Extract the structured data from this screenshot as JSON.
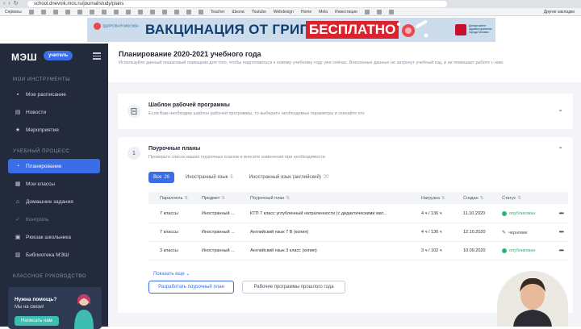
{
  "browser": {
    "url": "school.dnevnik.mos.ru/journal/study/plans",
    "bookmarks": [
      "Сервисы",
      "",
      "",
      "",
      "",
      "",
      "",
      "",
      "",
      "",
      "",
      "",
      "",
      "",
      "",
      "",
      "Teacher",
      "Школа",
      "Youtube",
      "Webdesign",
      "Home",
      "Mela",
      "Инвестиции",
      "",
      "",
      ""
    ],
    "other_bookmarks": "Другие закладки"
  },
  "banner": {
    "logo_text": "ЗДОРОВАЯ МОСКВА",
    "headline": "ВАКЦИНАЦИЯ ОТ ГРИППА",
    "free_badge": "БЕСПЛАТНО",
    "right_text": "Департамент здравоохранения города Москвы",
    "colors": {
      "bg": "#ccdcea",
      "headline": "#0f3e73",
      "badge": "#d9232d"
    }
  },
  "sidebar": {
    "brand": "МЭШ",
    "badge": "учитель",
    "sections": [
      {
        "title": "МОИ ИНСТРУМЕНТЫ",
        "items": [
          {
            "label": "Мое расписание",
            "icon": "briefcase-icon"
          },
          {
            "label": "Новости",
            "icon": "document-icon"
          },
          {
            "label": "Мероприятия",
            "icon": "star-icon"
          }
        ]
      },
      {
        "title": "УЧЕБНЫЙ ПРОЦЕСС",
        "items": [
          {
            "label": "Планирование",
            "icon": "clock-icon",
            "active": true
          },
          {
            "label": "Мои классы",
            "icon": "people-icon"
          },
          {
            "label": "Домашние задания",
            "icon": "home-icon"
          },
          {
            "label": "Контроль",
            "icon": "check-icon",
            "dim": true
          },
          {
            "label": "Рюкзак школьника",
            "icon": "backpack-icon"
          },
          {
            "label": "Библиотека МЭШ",
            "icon": "book-icon"
          }
        ]
      },
      {
        "title": "КЛАССНОЕ РУКОВОДСТВО",
        "items": []
      }
    ],
    "help": {
      "title": "Нужна помощь?",
      "subtitle": "Мы на связи!",
      "button": "Написать нам"
    }
  },
  "main": {
    "title": "Планирование 2020-2021 учебного года",
    "description": "Используйте данный пошаговый помощник для того, чтобы подготовиться к новому учебному году уже сейчас. Внесенные данные не затронут учебный год, и не помешает работе с ним.",
    "template_card": {
      "title": "Шаблон рабочей программы",
      "description": "Если Вам необходим шаблон рабочей программы, то выберите необходимые параметры и скачайте его"
    },
    "lesson_plans": {
      "step": "1",
      "title": "Поурочные планы",
      "description": "Проверьте список ваших поурочных планов и внесите изменения при необходимости",
      "tabs": [
        {
          "label": "Все",
          "count": "26",
          "active": true
        },
        {
          "label": "Иностранный язык",
          "count": "5"
        },
        {
          "label": "Иностранный язык (английский)",
          "count": "20"
        }
      ],
      "columns": [
        "Параллель",
        "Предмет",
        "Поурочный план",
        "Нагрузка",
        "Создан",
        "Статус"
      ],
      "rows": [
        {
          "parallel": "7 классы",
          "subject": "Иностранный ...",
          "plan": "КТП 7 класс углубленный натраленности (с дидактическими мат...",
          "load": "4 ч / 136 ч",
          "created": "11.10.2020",
          "status": "опубликован",
          "status_type": "ok"
        },
        {
          "parallel": "7 классы",
          "subject": "Иностранный ...",
          "plan": "Английский язык 7 В (копия)",
          "load": "4 ч / 136 ч",
          "created": "12.10.2020",
          "status": "черновик",
          "status_type": "draft"
        },
        {
          "parallel": "3 классы",
          "subject": "Иностранный ...",
          "plan": "Английский язык 3 класс (копия)",
          "load": "3 ч / 102 ч",
          "created": "10.09.2020",
          "status": "опубликован",
          "status_type": "ok"
        }
      ],
      "show_more": "Показать еще",
      "buttons": {
        "primary": "Разработать поурочный план",
        "secondary": "Рабочие программы прошлого года"
      }
    }
  }
}
